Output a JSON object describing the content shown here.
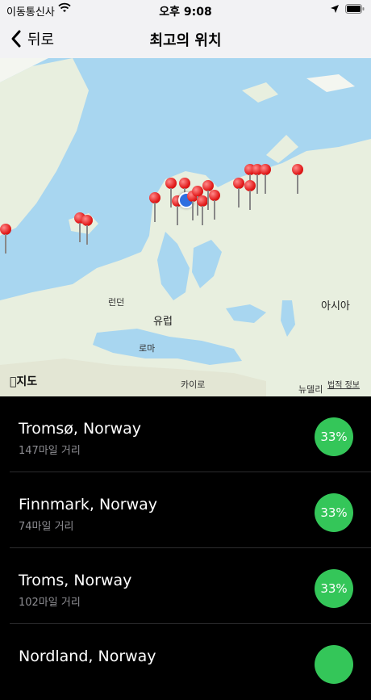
{
  "status_bar": {
    "carrier": "이동통신사",
    "time": "오후 9:08"
  },
  "nav": {
    "back_label": "뒤로",
    "title": "최고의 위치"
  },
  "map": {
    "labels": {
      "london": "런던",
      "europe": "유럽",
      "rome": "로마",
      "cairo": "카이로",
      "asia": "아시아",
      "new_delhi": "뉴델리",
      "legal": "법적 정보",
      "maps_logo": "지도"
    }
  },
  "locations": [
    {
      "name": "Tromsø, Norway",
      "distance": "147마일 거리",
      "score": "33%"
    },
    {
      "name": "Finnmark, Norway",
      "distance": "74마일 거리",
      "score": "33%"
    },
    {
      "name": "Troms, Norway",
      "distance": "102마일 거리",
      "score": "33%"
    },
    {
      "name": "Nordland, Norway",
      "distance": "",
      "score": ""
    }
  ],
  "colors": {
    "badge_green": "#34c659",
    "pin_red": "#e21c1c",
    "water": "#a8d6f0",
    "land": "#e8efdf"
  }
}
